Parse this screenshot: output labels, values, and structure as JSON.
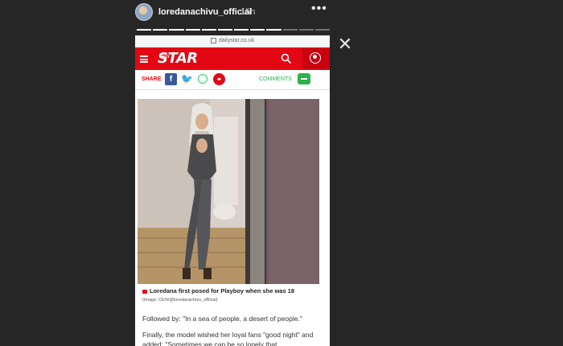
{
  "story": {
    "username": "loredanachivu_official",
    "time": "15h",
    "more_label": "•••",
    "close_label": "✕",
    "progress_segments": 12,
    "progress_done": 9
  },
  "browser": {
    "url": "dailystar.co.uk"
  },
  "site": {
    "logo_small": "DAILY",
    "logo": "STAR",
    "brand_color": "#e30613",
    "icons": [
      "menu-icon",
      "search-icon",
      "account-icon"
    ]
  },
  "share_bar": {
    "share_label": "SHARE",
    "facebook": "f",
    "twitter": "🐦",
    "comments_label": "COMMENTS"
  },
  "article": {
    "caption": "Loredana first posed for Playboy when she was 18",
    "credit": "(Image: CEN/@loredanachivu_official)",
    "paragraph1": "Followed by: \"In a sea of people, a desert of people.\"",
    "paragraph2": "Finally, the model wished her loyal fans \"good night\" and added: \"Sometimes we can be so lonely that"
  }
}
